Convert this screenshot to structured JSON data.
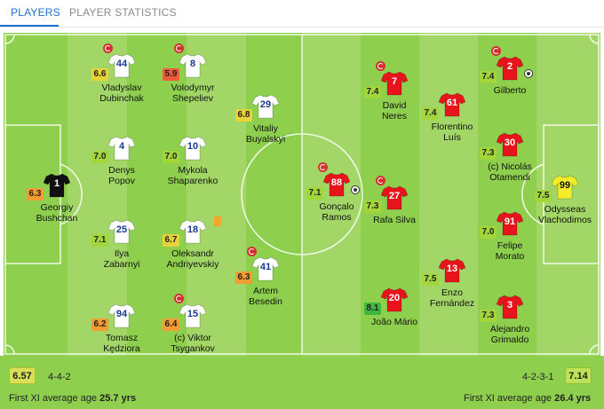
{
  "tabs": [
    {
      "label": "PLAYERS",
      "active": true
    },
    {
      "label": "PLAYER STATISTICS",
      "active": false
    }
  ],
  "home": {
    "team_rating": "6.57",
    "formation": "4-4-2",
    "avg_age_label": "First XI average age",
    "avg_age_value": "25.7 yrs",
    "shirt_color": "#ffffff",
    "shirt_number_color": "#1a3a8f",
    "gk_shirt_color": "#111111",
    "players": [
      {
        "id": "bushchan",
        "name": "Georgiy\nBushchan",
        "number": "1",
        "rating": "6.3",
        "rating_color": "#f39c34",
        "gk": true
      },
      {
        "id": "dubinchak",
        "name": "Vladyslav\nDubinchak",
        "number": "44",
        "rating": "6.6",
        "rating_color": "#e8d23a",
        "sub": true
      },
      {
        "id": "popov",
        "name": "Denys\nPopov",
        "number": "4",
        "rating": "7.0",
        "rating_color": "#a3d63a"
      },
      {
        "id": "zabarnyi",
        "name": "Ilya\nZabarnyi",
        "number": "25",
        "rating": "7.1",
        "rating_color": "#a3d63a"
      },
      {
        "id": "kedziora",
        "name": "Tomasz\nKędziora",
        "number": "94",
        "rating": "6.2",
        "rating_color": "#f39c34"
      },
      {
        "id": "shepeliev",
        "name": "Volodymyr\nShepeliev",
        "number": "8",
        "rating": "5.9",
        "rating_color": "#f05a3a",
        "sub": true
      },
      {
        "id": "shaparenko",
        "name": "Mykola\nShaparenko",
        "number": "10",
        "rating": "7.0",
        "rating_color": "#a3d63a"
      },
      {
        "id": "andriyevskiy",
        "name": "Oleksandr\nAndriyevskiy",
        "number": "18",
        "rating": "6.7",
        "rating_color": "#e8d23a",
        "card": true
      },
      {
        "id": "tsygankov",
        "name": "(c) Viktor\nTsygankov",
        "number": "15",
        "rating": "6.4",
        "rating_color": "#f39c34",
        "sub": true
      },
      {
        "id": "buyalskyi",
        "name": "Vitaliy\nBuyalskyi",
        "number": "29",
        "rating": "6.8",
        "rating_color": "#e8d23a"
      },
      {
        "id": "besedin",
        "name": "Artem\nBesedin",
        "number": "41",
        "rating": "6.3",
        "rating_color": "#f39c34",
        "sub": true
      }
    ]
  },
  "away": {
    "team_rating": "7.14",
    "formation": "4-2-3-1",
    "avg_age_label": "First XI average age",
    "avg_age_value": "26.4 yrs",
    "shirt_color": "#e8141b",
    "shirt_number_color": "#ffffff",
    "gk_shirt_color": "#f2ec2a",
    "players": [
      {
        "id": "ramos",
        "name": "Gonçalo\nRamos",
        "number": "88",
        "rating": "7.1",
        "rating_color": "#a3d63a",
        "sub": true,
        "goal": true
      },
      {
        "id": "neres",
        "name": "David\nNeres",
        "number": "7",
        "rating": "7.4",
        "rating_color": "#a3d63a",
        "sub": true
      },
      {
        "id": "rafa",
        "name": "Rafa Silva",
        "number": "27",
        "rating": "7.3",
        "rating_color": "#a3d63a",
        "sub": true
      },
      {
        "id": "joao",
        "name": "João Mário",
        "number": "20",
        "rating": "8.1",
        "rating_color": "#3fb73f"
      },
      {
        "id": "florentino",
        "name": "Florentino\nLuís",
        "number": "61",
        "rating": "7.4",
        "rating_color": "#a3d63a"
      },
      {
        "id": "enzo",
        "name": "Enzo\nFernández",
        "number": "13",
        "rating": "7.5",
        "rating_color": "#a3d63a"
      },
      {
        "id": "gilberto",
        "name": "Gilberto",
        "number": "2",
        "rating": "7.4",
        "rating_color": "#a3d63a",
        "sub": true,
        "goal": true
      },
      {
        "id": "otamendi",
        "name": "(c) Nicolás\nOtamendi",
        "number": "30",
        "rating": "7.3",
        "rating_color": "#a3d63a"
      },
      {
        "id": "morato",
        "name": "Felipe\nMorato",
        "number": "91",
        "rating": "7.0",
        "rating_color": "#a3d63a"
      },
      {
        "id": "grimaldo",
        "name": "Alejandro\nGrimaldo",
        "number": "3",
        "rating": "7.3",
        "rating_color": "#a3d63a"
      },
      {
        "id": "vlachodimos",
        "name": "Odysseas\nVlachodimos",
        "number": "99",
        "rating": "7.5",
        "rating_color": "#a3d63a",
        "gk": true
      }
    ]
  }
}
